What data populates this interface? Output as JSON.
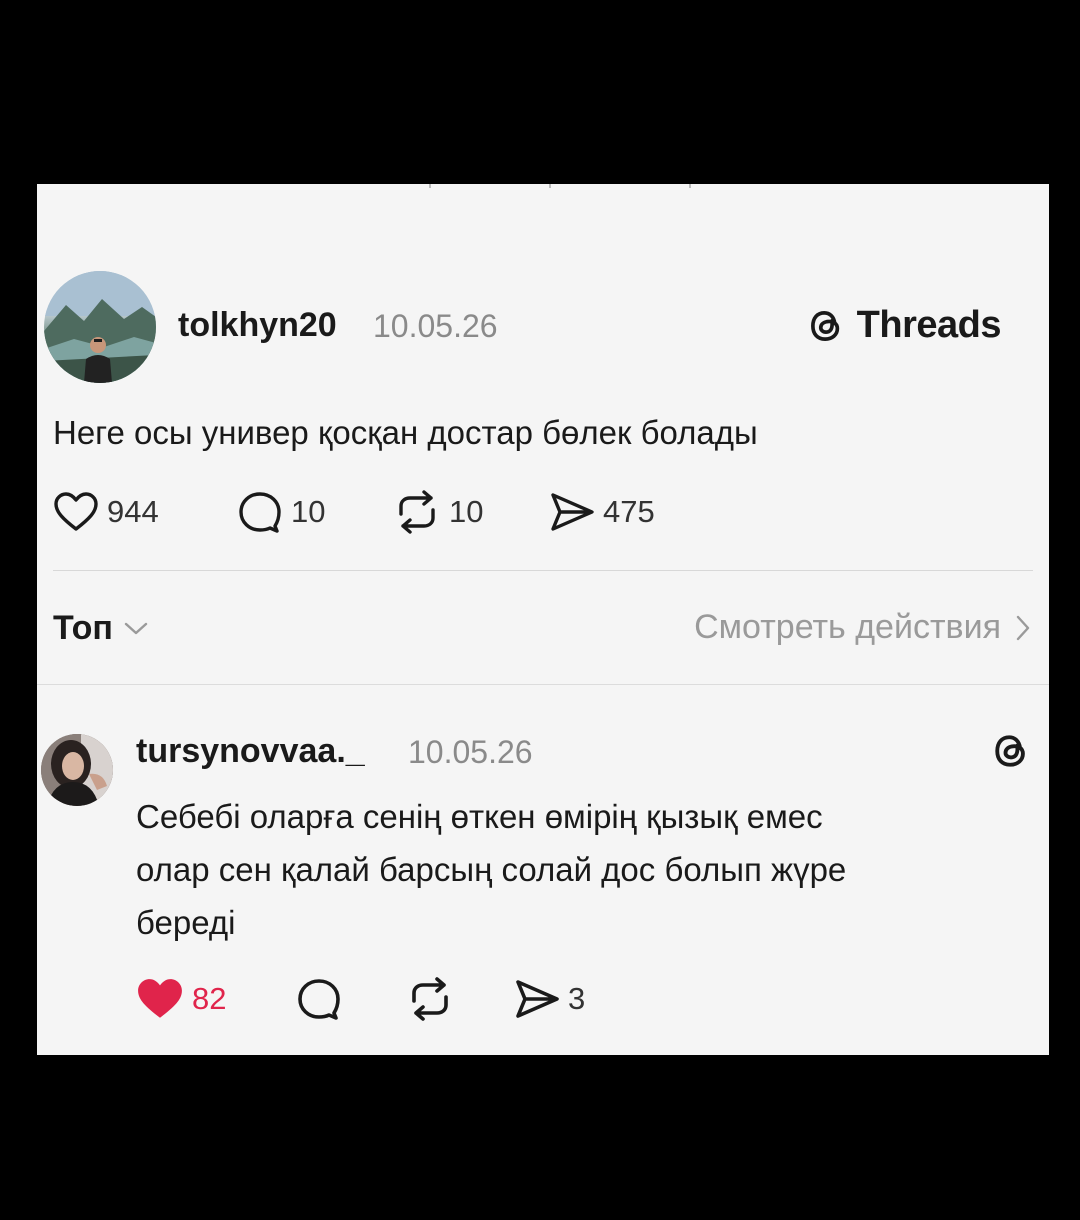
{
  "post": {
    "username": "tolkhyn20",
    "date": "10.05.26",
    "brand": "Threads",
    "text": "Неге осы универ қосқан достар бөлек болады",
    "likes": "944",
    "comments": "10",
    "reposts": "10",
    "shares": "475"
  },
  "sort": {
    "label": "Топ",
    "view_activity": "Смотреть действия"
  },
  "reply": {
    "username": "tursynovvaa._",
    "date": "10.05.26",
    "lines": [
      "Себебі оларға сенің өткен өмірің  қызық емес",
      "олар сен қалай барсың солай дос болып жүре",
      "береді"
    ],
    "likes": "82",
    "shares": "3",
    "liked": true
  },
  "colors": {
    "like_red": "#e0244b",
    "background": "#f5f5f5",
    "frame": "#000000"
  },
  "icons": [
    "heart-icon",
    "comment-icon",
    "repost-icon",
    "share-icon",
    "threads-logo-icon",
    "chevron-down-icon",
    "chevron-right-icon"
  ]
}
